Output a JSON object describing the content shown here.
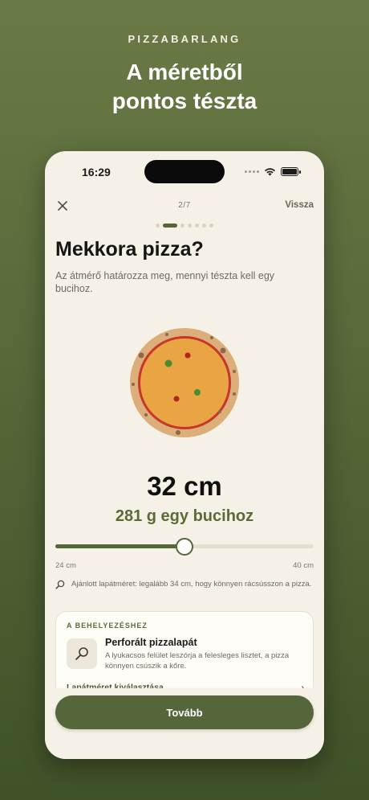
{
  "promo": {
    "brand": "PIZZABARLANG",
    "headline_line1": "A méretből",
    "headline_line2": "pontos tészta"
  },
  "status_bar": {
    "time": "16:29",
    "icons": [
      "signal-icon",
      "wifi-icon",
      "battery-icon"
    ]
  },
  "nav": {
    "close_icon": "close-icon",
    "step": "2/7",
    "back_label": "Vissza",
    "step_current": 2,
    "step_total": 7
  },
  "question": {
    "title": "Mekkora pizza?",
    "subtitle": "Az átmérő határozza meg, mennyi tészta kell egy bucihoz."
  },
  "result": {
    "size": "32 cm",
    "dough": "281 g egy bucihoz"
  },
  "slider": {
    "min_label": "24 cm",
    "max_label": "40 cm",
    "min": 24,
    "max": 40,
    "value": 32
  },
  "hint": {
    "icon": "search-icon",
    "text": "Ajánlott lapátméret: legalább 34 cm, hogy könnyen rácsússzon a pizza."
  },
  "card": {
    "section": "A BEHELYEZÉSHEZ",
    "icon": "peel-icon",
    "title": "Perforált pizzalapát",
    "description": "A lyukacsos felület leszórja a felesleges lisztet, a pizza könnyen csúszik a kőre.",
    "link": "Lapátméret kiválasztása",
    "link_icon": "chevron-right-icon"
  },
  "cta": {
    "label": "Tovább"
  },
  "colors": {
    "accent": "#55663a",
    "background": "#f5f1e6",
    "pizza_crust": "#dcae7a",
    "pizza_sauce": "#c8352a",
    "pizza_cheese": "#e9a444"
  }
}
